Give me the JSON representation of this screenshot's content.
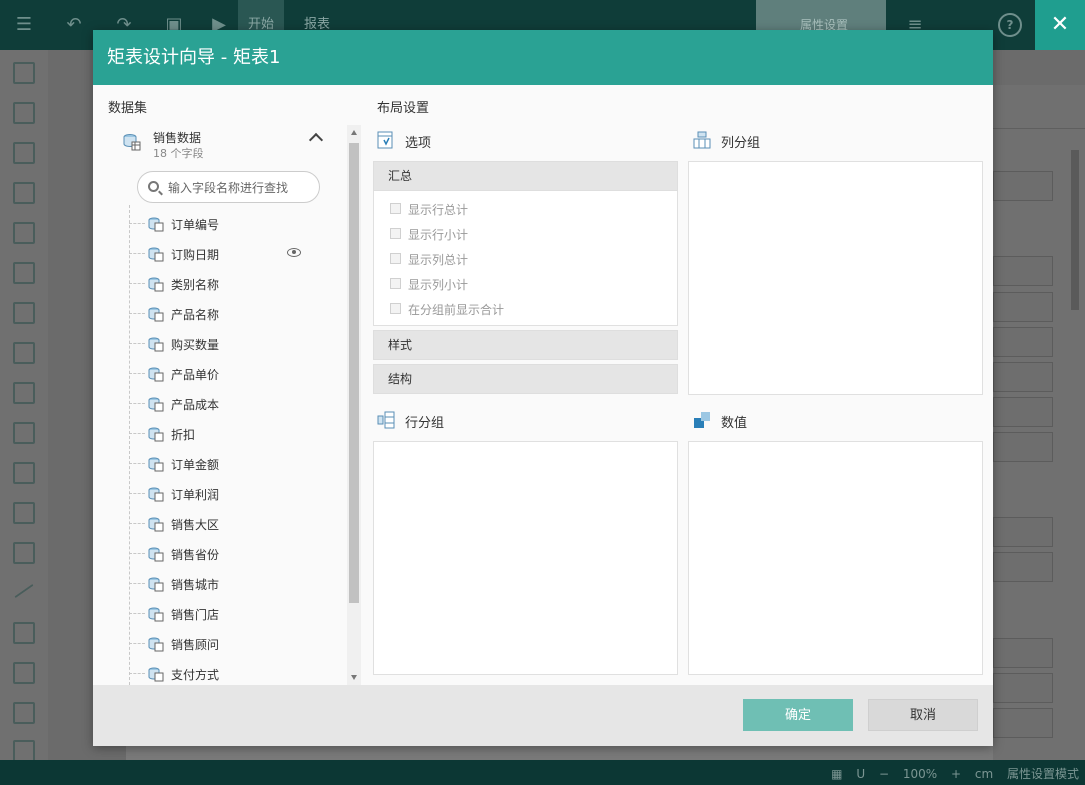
{
  "app": {
    "tabs": [
      {
        "label": "开始"
      },
      {
        "label": "报表"
      }
    ],
    "property_tab_label": "属性设置",
    "status": {
      "zoom": "100%",
      "unit": "cm",
      "mode_label": "属性设置模式",
      "minus": "−",
      "plus": "+"
    }
  },
  "dialog": {
    "title": "矩表设计向导 - 矩表1",
    "dataset_section_label": "数据集",
    "layout_section_label": "布局设置",
    "dataset": {
      "name": "销售数据",
      "field_count_label": "18 个字段",
      "search_placeholder": "输入字段名称进行查找",
      "fields": [
        {
          "label": "订单编号"
        },
        {
          "label": "订购日期"
        },
        {
          "label": "类别名称"
        },
        {
          "label": "产品名称"
        },
        {
          "label": "购买数量"
        },
        {
          "label": "产品单价"
        },
        {
          "label": "产品成本"
        },
        {
          "label": "折扣"
        },
        {
          "label": "订单金额"
        },
        {
          "label": "订单利润"
        },
        {
          "label": "销售大区"
        },
        {
          "label": "销售省份"
        },
        {
          "label": "销售城市"
        },
        {
          "label": "销售门店"
        },
        {
          "label": "销售顾问"
        },
        {
          "label": "支付方式"
        }
      ]
    },
    "options_panel": {
      "label": "选项",
      "groups": {
        "summary": "汇总",
        "style": "样式",
        "structure": "结构"
      },
      "checkboxes": [
        {
          "label": "显示行总计",
          "checked": false
        },
        {
          "label": "显示行小计",
          "checked": false
        },
        {
          "label": "显示列总计",
          "checked": false
        },
        {
          "label": "显示列小计",
          "checked": false
        },
        {
          "label": "在分组前显示合计",
          "checked": false
        }
      ]
    },
    "column_group_label": "列分组",
    "row_group_label": "行分组",
    "values_label": "数值",
    "buttons": {
      "ok": "确定",
      "cancel": "取消"
    }
  },
  "colors": {
    "header_teal": "#2aa294",
    "ok_button": "#6fbfb4",
    "topbar_dark": "#0f3d39",
    "close_button": "#1f9e8f"
  }
}
